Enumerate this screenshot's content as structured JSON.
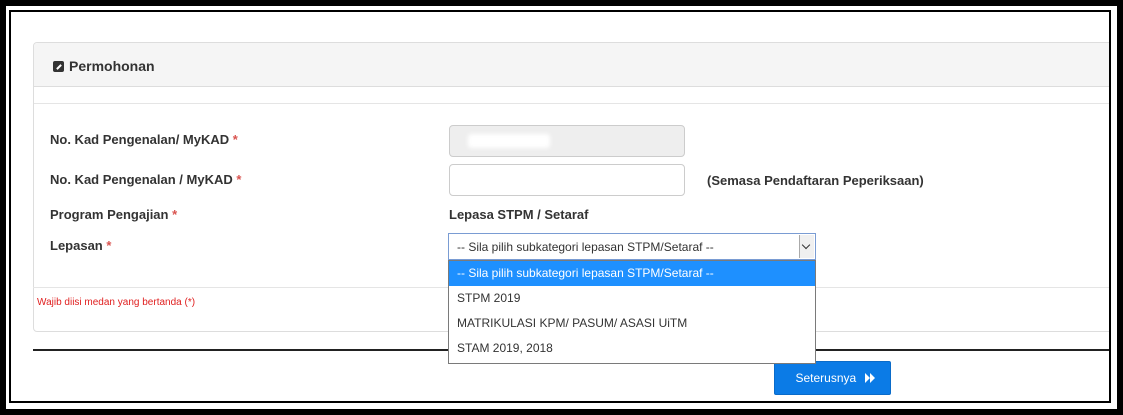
{
  "panel": {
    "title": "Permohonan",
    "title_icon": "edit-icon"
  },
  "form": {
    "mykad_label": "No. Kad Pengenalan/ MyKAD",
    "mykad_value": "",
    "mykad_exam_label": "No. Kad Pengenalan / MyKAD",
    "mykad_exam_value": "",
    "mykad_exam_hint": "(Semasa Pendaftaran Peperiksaan)",
    "program_label": "Program Pengajian",
    "program_value": "Lepasa STPM / Setaraf",
    "lepasan_label": "Lepasan",
    "required_mark": "*",
    "lepasan_selected": "-- Sila pilih subkategori lepasan STPM/Setaraf --",
    "lepasan_options": [
      "-- Sila pilih subkategori lepasan STPM/Setaraf --",
      "STPM 2019",
      "MATRIKULASI KPM/ PASUM/ ASASI UiTM",
      "STAM 2019, 2018"
    ]
  },
  "footer": {
    "required_note": "Wajib diisi medan yang bertanda (*)"
  },
  "actions": {
    "next_label": "Seterusnya",
    "next_icon": "fast-forward-icon",
    "primary_color": "#0b7be6"
  }
}
